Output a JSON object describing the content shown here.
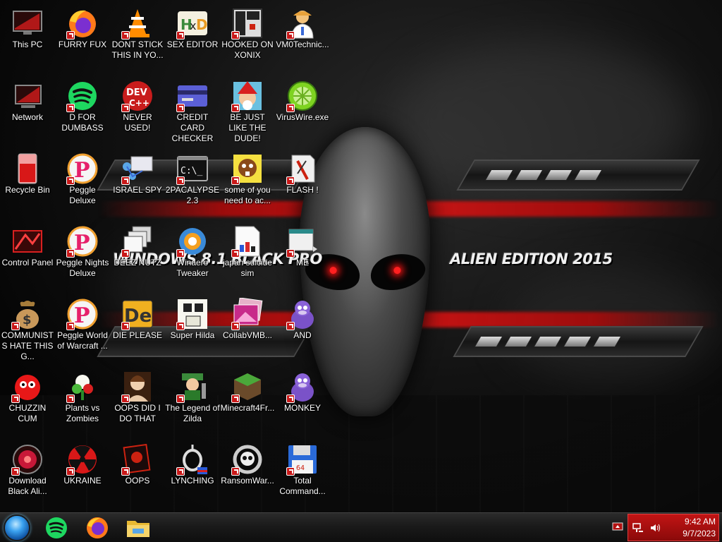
{
  "wallpaper": {
    "title": "WINDOWS 8.1 BLACK PRO",
    "subtitle": "ALIEN EDITION 2015"
  },
  "desktop": {
    "icons": [
      {
        "id": "this-pc",
        "label": "This PC",
        "icon": "monitor-icon"
      },
      {
        "id": "furry-fux",
        "label": "FURRY FUX",
        "icon": "firefox-icon"
      },
      {
        "id": "dont-stick",
        "label": "DONT STICK THIS IN YO...",
        "icon": "vlc-cone-icon"
      },
      {
        "id": "sex-editor",
        "label": "SEX EDITOR",
        "icon": "hxd-icon"
      },
      {
        "id": "hooked-on-xonix",
        "label": "HOOKED ON XONIX",
        "icon": "xonix-icon"
      },
      {
        "id": "vm0technic",
        "label": "VM0Technic...",
        "icon": "doctor-icon"
      },
      {
        "id": "network",
        "label": "Network",
        "icon": "network-icon"
      },
      {
        "id": "d-for-dumbass",
        "label": "D FOR DUMBASS",
        "icon": "spotify-icon"
      },
      {
        "id": "never-used",
        "label": "NEVER USED!",
        "icon": "devcpp-icon"
      },
      {
        "id": "credit-card-checker",
        "label": "CREDIT CARD CHECKER",
        "icon": "credit-card-icon"
      },
      {
        "id": "be-just-like-the-dude",
        "label": "BE JUST LIKE THE DUDE!",
        "icon": "santa-elf-icon"
      },
      {
        "id": "viruswire",
        "label": "VirusWire.exe",
        "icon": "limewire-icon"
      },
      {
        "id": "recycle-bin",
        "label": "Recycle Bin",
        "icon": "recycle-bin-icon"
      },
      {
        "id": "peggle-deluxe",
        "label": "Peggle Deluxe",
        "icon": "peggle-icon"
      },
      {
        "id": "israel-spy",
        "label": "ISRAEL SPY",
        "icon": "spy-network-icon"
      },
      {
        "id": "2pacalypse",
        "label": "2PACALYPSE 2.3",
        "icon": "terminal-icon"
      },
      {
        "id": "some-of-you",
        "label": "some of you need to ac...",
        "icon": "beaver-icon"
      },
      {
        "id": "flash",
        "label": "FLASH !",
        "icon": "flash-icon"
      },
      {
        "id": "control-panel",
        "label": "Control Panel",
        "icon": "control-panel-icon"
      },
      {
        "id": "peggle-nights",
        "label": "Peggle Nights Deluxe",
        "icon": "peggle-icon"
      },
      {
        "id": "deez-nutz",
        "label": "DEEZ NUTZ",
        "icon": "stacked-windows-icon"
      },
      {
        "id": "winaero-tweaker",
        "label": "Winaero Tweaker",
        "icon": "winaero-icon"
      },
      {
        "id": "japan-suicide-sim",
        "label": "japan suicide sim",
        "icon": "document-icon"
      },
      {
        "id": "me",
        "label": "ME",
        "icon": "window-icon"
      },
      {
        "id": "communists",
        "label": "COMMUNISTS HATE THIS G...",
        "icon": "money-bag-icon"
      },
      {
        "id": "peggle-world",
        "label": "Peggle World of Warcraft ...",
        "icon": "peggle-icon"
      },
      {
        "id": "die-please",
        "label": "DIE PLEASE",
        "icon": "de-icon"
      },
      {
        "id": "super-hilda",
        "label": "Super Hilda",
        "icon": "pixel-character-icon"
      },
      {
        "id": "collabvmb",
        "label": "CollabVMB...",
        "icon": "photo-stack-icon"
      },
      {
        "id": "and",
        "label": "AND",
        "icon": "bonzi-icon"
      },
      {
        "id": "chuzzin-cum",
        "label": "CHUZZIN CUM",
        "icon": "chuzzle-icon"
      },
      {
        "id": "plants-vs-zombies",
        "label": "Plants vs Zombies",
        "icon": "plant-icon"
      },
      {
        "id": "oops-did-i",
        "label": "OOPS DID I DO THAT",
        "icon": "portrait-icon"
      },
      {
        "id": "legend-of-zilda",
        "label": "The Legend of Zilda",
        "icon": "zelda-icon"
      },
      {
        "id": "minecraft4fr",
        "label": "Minecraft4Fr...",
        "icon": "minecraft-icon"
      },
      {
        "id": "monkey",
        "label": "MONKEY",
        "icon": "bonzi-icon"
      },
      {
        "id": "download-black-ali",
        "label": "Download Black Ali...",
        "icon": "alien-orb-icon"
      },
      {
        "id": "ukraine",
        "label": "UKRAINE",
        "icon": "radiation-icon"
      },
      {
        "id": "oops",
        "label": "OOPS",
        "icon": "red-skull-card-icon"
      },
      {
        "id": "lynching",
        "label": "LYNCHING",
        "icon": "noose-icon"
      },
      {
        "id": "ransomwar",
        "label": "RansomWar...",
        "icon": "skull-ring-icon"
      },
      {
        "id": "total-command",
        "label": "Total Command...",
        "icon": "floppy-disk-icon"
      }
    ]
  },
  "taskbar": {
    "pinned": [
      {
        "name": "spotify-taskbar-button",
        "icon": "spotify-icon"
      },
      {
        "name": "firefox-taskbar-button",
        "icon": "firefox-icon"
      },
      {
        "name": "file-explorer-taskbar-button",
        "icon": "folder-icon"
      }
    ],
    "tray": {
      "time": "9:42 AM",
      "date": "9/7/2023"
    }
  }
}
